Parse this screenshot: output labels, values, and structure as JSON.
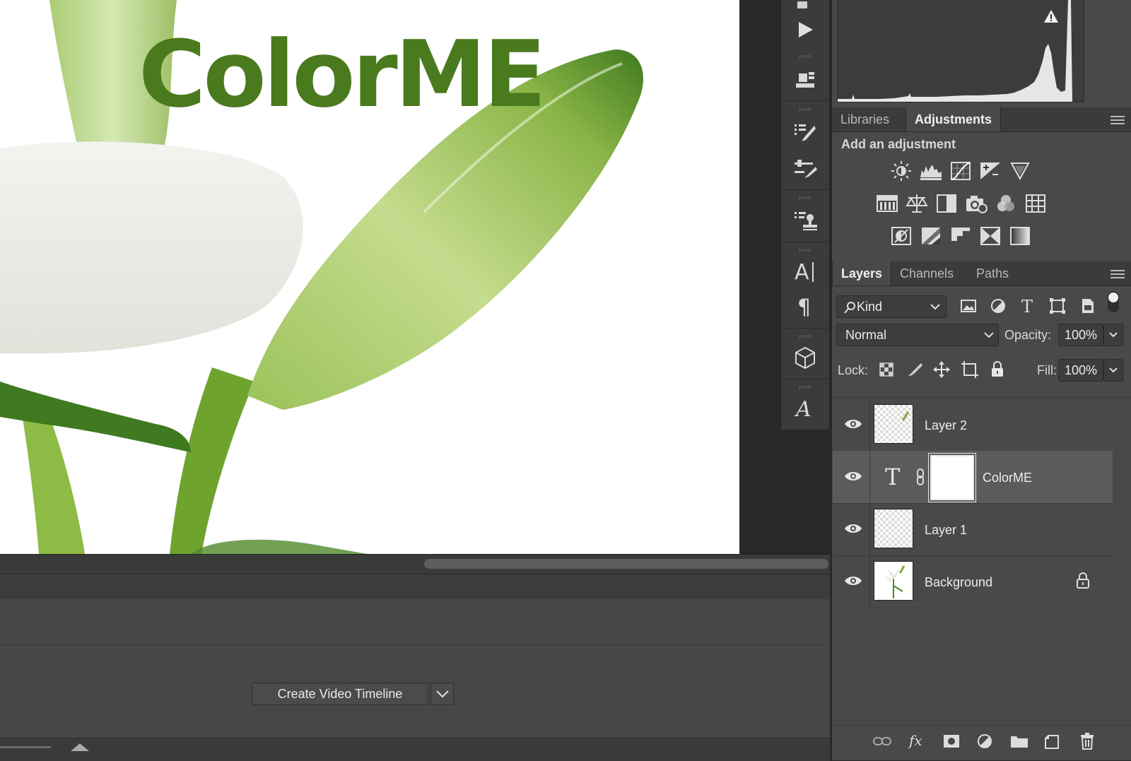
{
  "canvas": {
    "text_overlay": "ColorME",
    "text_color": "#4a7a1e"
  },
  "timeline": {
    "create_button_label": "Create Video Timeline"
  },
  "adjustments_panel": {
    "tabs": [
      "Libraries",
      "Adjustments"
    ],
    "active_tab": "Adjustments",
    "heading": "Add an adjustment",
    "icons_row1": [
      "brightness-contrast-icon",
      "levels-icon",
      "curves-icon",
      "exposure-icon",
      "vibrance-icon"
    ],
    "icons_row2": [
      "hue-saturation-icon",
      "color-balance-icon",
      "black-white-icon",
      "photo-filter-icon",
      "channel-mixer-icon",
      "color-lookup-icon"
    ],
    "icons_row3": [
      "invert-icon",
      "posterize-icon",
      "threshold-icon",
      "selective-color-icon",
      "gradient-map-icon"
    ]
  },
  "layers_panel": {
    "tabs": [
      "Layers",
      "Channels",
      "Paths"
    ],
    "active_tab": "Layers",
    "filter_kind": "Kind",
    "blend_mode": "Normal",
    "opacity_label": "Opacity:",
    "opacity_value": "100%",
    "lock_label": "Lock:",
    "fill_label": "Fill:",
    "fill_value": "100%",
    "layers": [
      {
        "name": "Layer 2",
        "type": "pixel",
        "visible": true,
        "selected": false
      },
      {
        "name": "ColorME",
        "type": "text",
        "visible": true,
        "selected": true
      },
      {
        "name": "Layer 1",
        "type": "pixel",
        "visible": true,
        "selected": false
      },
      {
        "name": "Background",
        "type": "background",
        "visible": true,
        "selected": false,
        "locked": true
      }
    ]
  },
  "colors": {
    "app_bg": "#282828",
    "panel_bg": "#494949",
    "selected_layer_bg": "#5b5b5b",
    "text_light": "#ececec",
    "histogram_fill": "#e6e6e6"
  }
}
